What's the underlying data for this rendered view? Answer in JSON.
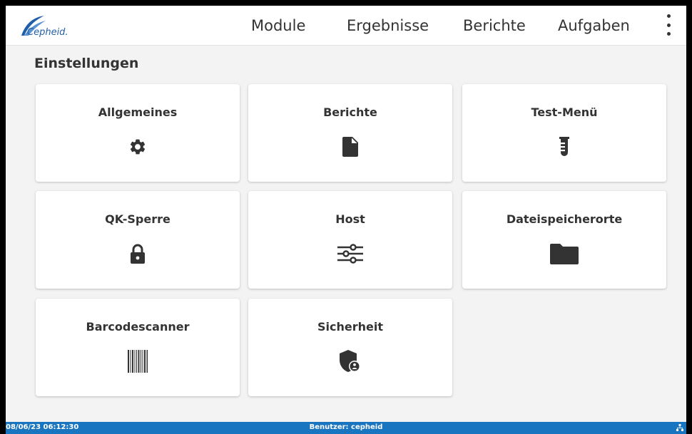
{
  "header": {
    "logo_text": "Cepheid.",
    "nav": [
      "Module",
      "Ergebnisse",
      "Berichte",
      "Aufgaben"
    ]
  },
  "page": {
    "title": "Einstellungen"
  },
  "tiles": [
    {
      "label": "Allgemeines",
      "icon": "gear-icon"
    },
    {
      "label": "Berichte",
      "icon": "document-icon"
    },
    {
      "label": "Test-Menü",
      "icon": "test-tube-icon"
    },
    {
      "label": "QK-Sperre",
      "icon": "lock-icon"
    },
    {
      "label": "Host",
      "icon": "sliders-icon"
    },
    {
      "label": "Dateispeicherorte",
      "icon": "folder-icon"
    },
    {
      "label": "Barcodescanner",
      "icon": "barcode-icon"
    },
    {
      "label": "Sicherheit",
      "icon": "security-shield-icon"
    }
  ],
  "status": {
    "datetime": "08/06/23 06:12:30",
    "user": "Benutzer: cepheid"
  },
  "colors": {
    "accent": "#1a75c0",
    "logo": "#1f5ea8",
    "icon": "#333333"
  }
}
